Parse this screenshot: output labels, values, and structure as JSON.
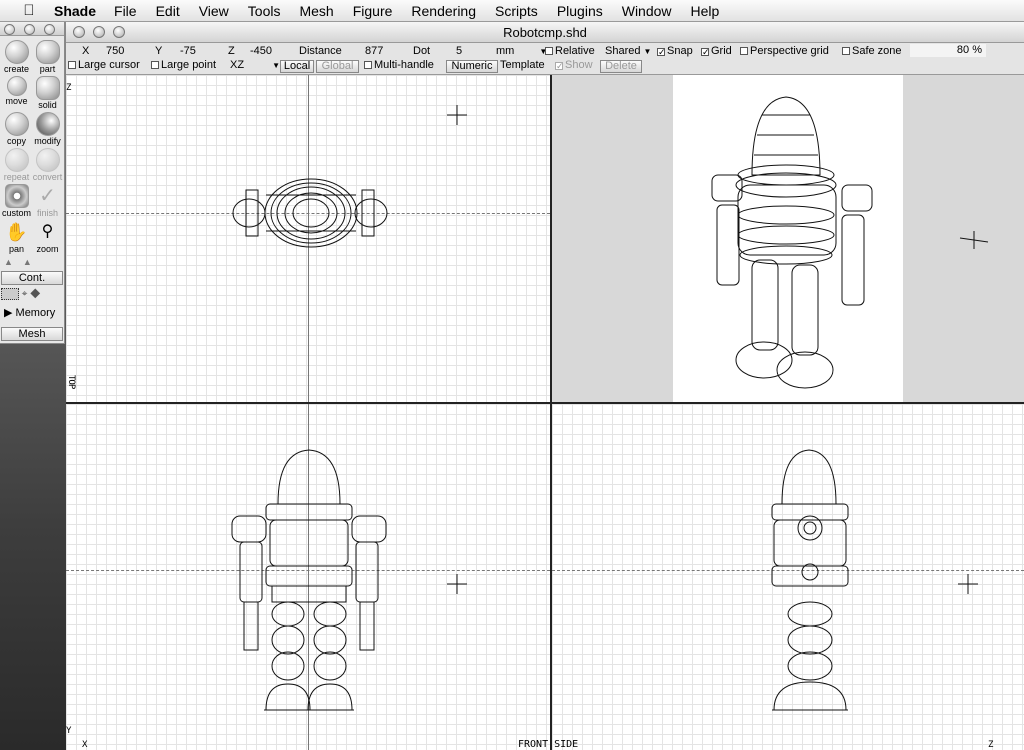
{
  "menubar": {
    "app_name": "Shade",
    "items": [
      "File",
      "Edit",
      "View",
      "Tools",
      "Mesh",
      "Figure",
      "Rendering",
      "Scripts",
      "Plugins",
      "Window",
      "Help"
    ]
  },
  "palette": {
    "tools": [
      {
        "label": "create",
        "icon": "sphere-icon"
      },
      {
        "label": "part",
        "icon": "part-icon"
      },
      {
        "label": "move",
        "icon": "move-icon"
      },
      {
        "label": "solid",
        "icon": "solid-icon"
      },
      {
        "label": "copy",
        "icon": "copy-icon"
      },
      {
        "label": "modify",
        "icon": "modify-icon"
      },
      {
        "label": "repeat",
        "icon": "repeat-icon"
      },
      {
        "label": "convert",
        "icon": "convert-icon"
      },
      {
        "label": "custom",
        "icon": "gear-icon"
      },
      {
        "label": "finish",
        "icon": "check-icon"
      },
      {
        "label": "pan",
        "icon": "hand-icon"
      },
      {
        "label": "zoom",
        "icon": "magnifier-icon"
      }
    ],
    "cont_label": "Cont.",
    "memory_label": "Memory",
    "mesh_label": "Mesh"
  },
  "window": {
    "title": "Robotcmp.shd"
  },
  "toolbar": {
    "x_label": "X",
    "x_value": "750",
    "y_label": "Y",
    "y_value": "-75",
    "z_label": "Z",
    "z_value": "-450",
    "distance_label": "Distance",
    "distance_value": "877",
    "dot_label": "Dot",
    "dot_value": "5",
    "unit": "mm",
    "relative_label": "Relative",
    "shared_label": "Shared",
    "snap_label": "Snap",
    "grid_label": "Grid",
    "perspective_grid_label": "Perspective grid",
    "safe_zone_label": "Safe zone",
    "zoom_percent": "80 %",
    "large_cursor_label": "Large cursor",
    "large_point_label": "Large point",
    "plane_value": "XZ",
    "local_label": "Local",
    "global_label": "Global",
    "multi_handle_label": "Multi-handle",
    "numeric_label": "Numeric",
    "template_label": "Template",
    "show_label": "Show",
    "delete_label": "Delete"
  },
  "views": {
    "top_label": "TOP",
    "bottom_label": "FRONT SIDE",
    "axis_x": "X",
    "axis_y": "Y",
    "axis_z": "Z",
    "axis_z2": "Z"
  }
}
